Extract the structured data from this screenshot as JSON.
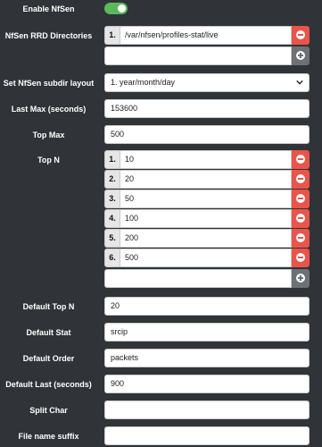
{
  "enable": {
    "label": "Enable NfSen",
    "on": true
  },
  "dirs": {
    "label": "NfSen RRD Directories",
    "items": [
      {
        "index": "1.",
        "value": "/var/nfsen/profiles-stat/live"
      }
    ]
  },
  "subdir": {
    "label": "Set NfSen subdir layout",
    "selected": "1. year/month/day"
  },
  "last_max": {
    "label": "Last Max (seconds)",
    "value": "153600"
  },
  "top_max": {
    "label": "Top Max",
    "value": "500"
  },
  "top_n": {
    "label": "Top N",
    "items": [
      {
        "index": "1.",
        "value": "10"
      },
      {
        "index": "2.",
        "value": "20"
      },
      {
        "index": "3.",
        "value": "50"
      },
      {
        "index": "4.",
        "value": "100"
      },
      {
        "index": "5.",
        "value": "200"
      },
      {
        "index": "6.",
        "value": "500"
      }
    ]
  },
  "default_top_n": {
    "label": "Default Top N",
    "value": "20"
  },
  "default_stat": {
    "label": "Default Stat",
    "value": "srcip"
  },
  "default_order": {
    "label": "Default Order",
    "value": "packets"
  },
  "default_last": {
    "label": "Default Last (seconds)",
    "value": "900"
  },
  "split_char": {
    "label": "Split Char",
    "value": ""
  },
  "file_suffix": {
    "label": "File name suffix",
    "value": ""
  },
  "icons": {
    "delete": "minus-circle-icon",
    "add": "plus-circle-icon",
    "dropdown": "chevron-down-icon"
  },
  "colors": {
    "toggle_on": "#5cb85c",
    "delete": "#e9544b",
    "add": "#6d7176",
    "background": "#303438"
  }
}
